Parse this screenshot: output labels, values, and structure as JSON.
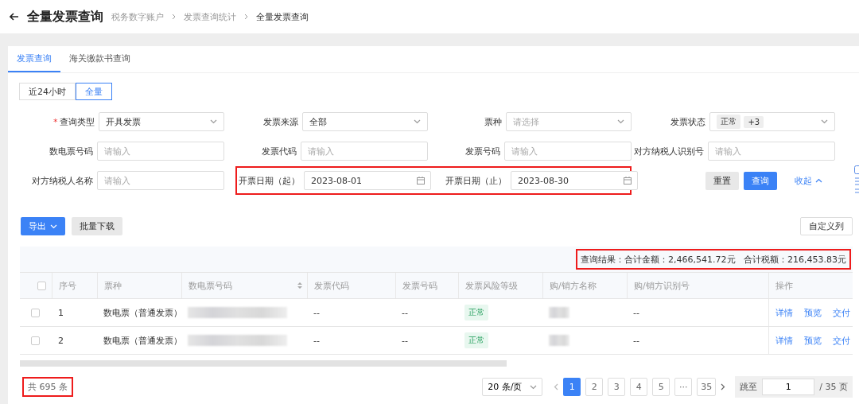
{
  "header": {
    "title": "全量发票查询",
    "breadcrumbs": [
      {
        "label": "税务数字账户",
        "current": false
      },
      {
        "label": "发票查询统计",
        "current": false
      },
      {
        "label": "全量发票查询",
        "current": true
      }
    ]
  },
  "tabs": [
    {
      "label": "发票查询",
      "selected": true
    },
    {
      "label": "海关缴款书查询",
      "selected": false
    }
  ],
  "range_toggle": [
    {
      "label": "近24小时",
      "selected": false
    },
    {
      "label": "全量",
      "selected": true
    }
  ],
  "filters": [
    [
      {
        "label": "查询类型",
        "required_mark": "*",
        "kind": "select",
        "value": "开具发票",
        "highlighted": false
      },
      {
        "label": "发票来源",
        "kind": "select",
        "value": "全部",
        "highlighted": false
      },
      {
        "label": "票种",
        "kind": "select",
        "placeholder": "请选择",
        "highlighted": false
      },
      {
        "label": "发票状态",
        "kind": "tags",
        "tags": [
          "正常",
          "+3"
        ],
        "highlighted": false
      }
    ],
    [
      {
        "label": "数电票号码",
        "kind": "input",
        "placeholder": "请输入",
        "highlighted": false
      },
      {
        "label": "发票代码",
        "kind": "input",
        "placeholder": "请输入",
        "highlighted": false
      },
      {
        "label": "发票号码",
        "kind": "input",
        "placeholder": "请输入",
        "highlighted": false
      },
      {
        "label": "对方纳税人识别号",
        "kind": "input",
        "placeholder": "请输入",
        "highlighted": false
      }
    ],
    [
      {
        "label": "对方纳税人名称",
        "kind": "input",
        "placeholder": "请输入",
        "highlighted": false
      },
      {
        "label": "开票日期（起）",
        "kind": "date",
        "value": "2023-08-01",
        "highlighted": true
      },
      {
        "label": "开票日期（止）",
        "kind": "date",
        "value": "2023-08-30",
        "highlighted": true
      }
    ]
  ],
  "filter_actions": {
    "reset": "重置",
    "query": "查询",
    "collapse": "收起"
  },
  "toolbar": {
    "export": "导出",
    "batch_download": "批量下载",
    "custom_columns": "自定义列"
  },
  "summary": {
    "text": "查询结果：合计金额：2,466,541.72元   合计税额：216,453.83元",
    "highlighted": true
  },
  "table": {
    "columns": [
      "序号",
      "票种",
      "数电票号码",
      "发票代码",
      "发票号码",
      "发票风险等级",
      "购/销方名称",
      "购/销方识别号",
      "操作"
    ],
    "select_all_checked": false,
    "rows": [
      {
        "checked": false,
        "index": "1",
        "type": "数电票（普通发票）",
        "code": "--",
        "number": "--",
        "risk": "正常",
        "buyer_id": "--",
        "actions": [
          "详情",
          "预览",
          "交付"
        ]
      },
      {
        "checked": false,
        "index": "2",
        "type": "数电票（普通发票）",
        "code": "--",
        "number": "--",
        "risk": "正常",
        "buyer_id": "--",
        "actions": [
          "详情",
          "预览",
          "交付"
        ]
      }
    ]
  },
  "pagination": {
    "total": "共 695 条",
    "total_highlighted": true,
    "page_size": "20 条/页",
    "pages": [
      {
        "label": "1",
        "selected": true
      },
      {
        "label": "2",
        "selected": false
      },
      {
        "label": "3",
        "selected": false
      },
      {
        "label": "4",
        "selected": false
      },
      {
        "label": "5",
        "selected": false
      },
      {
        "label": "···",
        "selected": false
      },
      {
        "label": "35",
        "selected": false
      }
    ],
    "jump_label": "跳至",
    "jump_value": "1",
    "page_count": "/ 35 页"
  }
}
